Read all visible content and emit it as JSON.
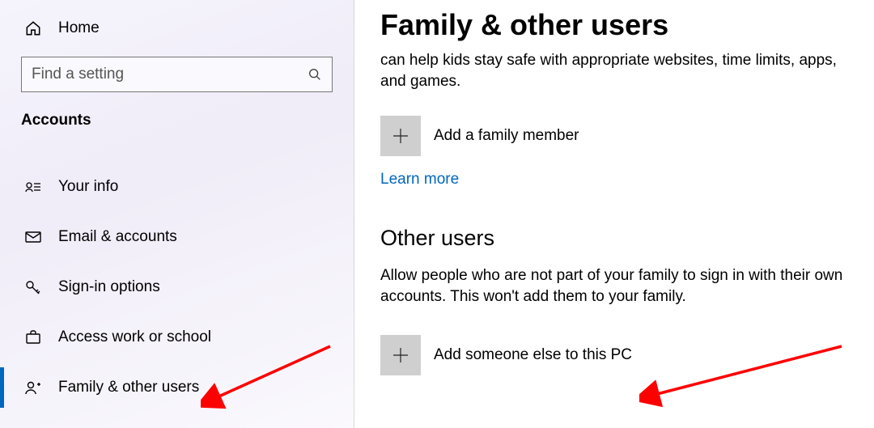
{
  "sidebar": {
    "home_label": "Home",
    "search_placeholder": "Find a setting",
    "section_label": "Accounts",
    "items": [
      {
        "label": "Your info"
      },
      {
        "label": "Email & accounts"
      },
      {
        "label": "Sign-in options"
      },
      {
        "label": "Access work or school"
      },
      {
        "label": "Family & other users"
      }
    ]
  },
  "main": {
    "title": "Family & other users",
    "family_desc": "can help kids stay safe with appropriate websites, time limits, apps, and games.",
    "add_family_label": "Add a family member",
    "learn_more": "Learn more",
    "other_heading": "Other users",
    "other_desc": "Allow people who are not part of your family to sign in with their own accounts. This won't add them to your family.",
    "add_other_label": "Add someone else to this PC"
  }
}
